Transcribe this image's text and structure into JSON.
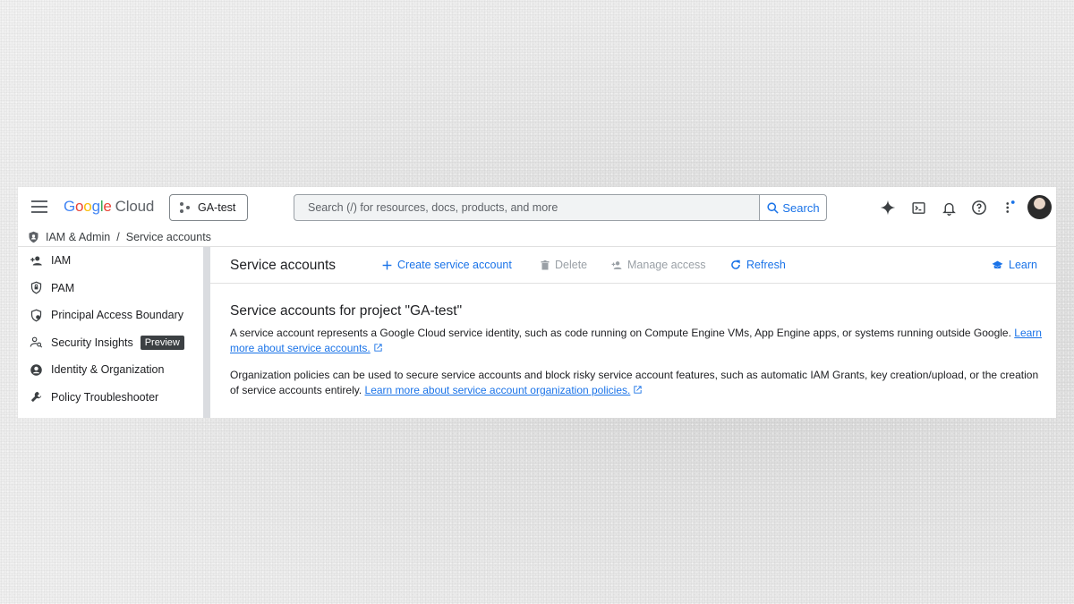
{
  "topbar": {
    "logo_google": [
      "G",
      "o",
      "o",
      "g",
      "l",
      "e"
    ],
    "logo_cloud": "Cloud",
    "project_name": "GA-test",
    "search_placeholder": "Search (/) for resources, docs, products, and more",
    "search_button": "Search",
    "icons": [
      "gemini-icon",
      "cloud-shell-icon",
      "notifications-icon",
      "help-icon",
      "more-vert-icon",
      "avatar"
    ]
  },
  "breadcrumb": {
    "section": "IAM & Admin",
    "separator": "/",
    "page": "Service accounts"
  },
  "sidebar": {
    "items": [
      {
        "label": "IAM",
        "icon": "person-add-icon"
      },
      {
        "label": "PAM",
        "icon": "shield-lock-icon"
      },
      {
        "label": "Principal Access Boundary",
        "icon": "boundary-icon"
      },
      {
        "label": "Security Insights",
        "icon": "person-search-icon",
        "badge": "Preview"
      },
      {
        "label": "Identity & Organization",
        "icon": "account-circle-icon"
      },
      {
        "label": "Policy Troubleshooter",
        "icon": "wrench-icon"
      }
    ]
  },
  "actions": {
    "title": "Service accounts",
    "create": "Create service account",
    "delete": "Delete",
    "manage": "Manage access",
    "refresh": "Refresh",
    "learn": "Learn"
  },
  "content": {
    "heading": "Service accounts for project \"GA-test\"",
    "para1": "A service account represents a Google Cloud service identity, such as code running on Compute Engine VMs, App Engine apps, or systems running outside Google. ",
    "para1_link": "Learn more about service accounts.",
    "para2": "Organization policies can be used to secure service accounts and block risky service account features, such as automatic IAM Grants, key creation/upload, or the creation of service accounts entirely. ",
    "para2_link": "Learn more about service account organization policies."
  },
  "colors": {
    "accent": "#1a73e8",
    "text": "#202124",
    "disabled": "#9aa0a6"
  }
}
